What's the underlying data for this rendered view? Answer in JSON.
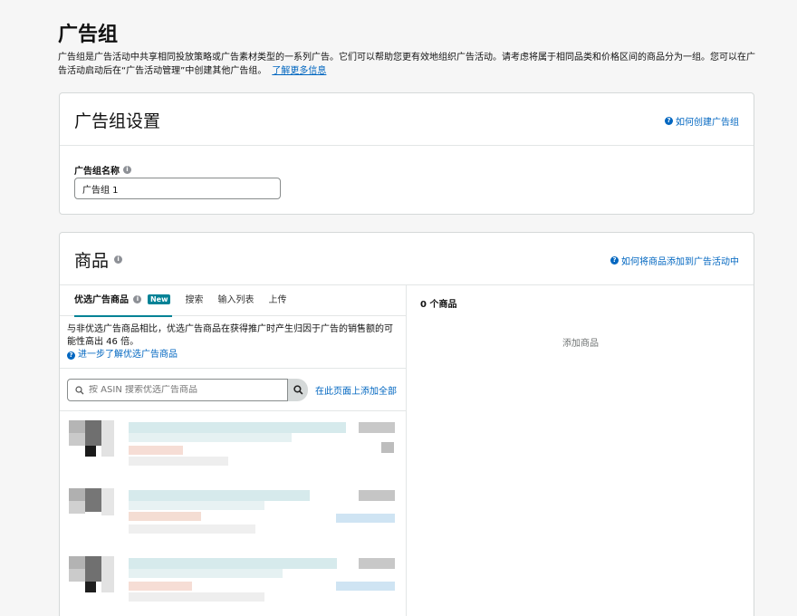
{
  "page": {
    "title": "广告组",
    "intro": "广告组是广告活动中共享相同投放策略或广告素材类型的一系列广告。它们可以帮助您更有效地组织广告活动。请考虑将属于相同品类和价格区间的商品分为一组。您可以在广告活动启动后在“广告活动管理”中创建其他广告组。",
    "learn_more": "了解更多信息"
  },
  "settings": {
    "title": "广告组设置",
    "help_link": "如何创建广告组",
    "name_label": "广告组名称",
    "name_value": "广告组 1"
  },
  "products": {
    "title": "商品",
    "help_link": "如何将商品添加到广告活动中",
    "tabs": [
      "优选广告商品",
      "搜索",
      "输入列表",
      "上传"
    ],
    "new_badge": "New",
    "promo_text": "与非优选广告商品相比，优选广告商品在获得推广时产生归因于广告的销售额的可能性高出 46 倍。",
    "promo_link": "进一步了解优选广告商品",
    "search_placeholder": "按 ASIN 搜索优选广告商品",
    "add_all": "在此页面上添加全部",
    "selected_count": "0 个商品",
    "empty_text": "添加商品"
  },
  "icons": {
    "help": "question-circle-icon",
    "info": "info-icon",
    "search": "search-icon"
  },
  "colors": {
    "link": "#0066c0",
    "accent_teal": "#008296"
  }
}
